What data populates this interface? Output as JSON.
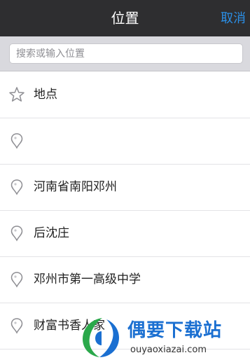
{
  "navbar": {
    "title": "位置",
    "cancel_label": "取消"
  },
  "search": {
    "placeholder": "搜索或输入位置",
    "value": ""
  },
  "list": {
    "items": [
      {
        "icon": "star-icon",
        "label": "地点"
      },
      {
        "icon": "location-pin-icon",
        "label": ""
      },
      {
        "icon": "location-pin-icon",
        "label": "河南省南阳邓州"
      },
      {
        "icon": "location-pin-icon",
        "label": "后沈庄"
      },
      {
        "icon": "location-pin-icon",
        "label": "邓州市第一高级中学"
      },
      {
        "icon": "location-pin-icon",
        "label": "财富书香人家"
      }
    ]
  },
  "watermark": {
    "title": "偶要下载站",
    "url": "ouyaoxiazai.com"
  },
  "colors": {
    "navbar_bg": "#2e2e30",
    "accent": "#2b8fe6",
    "search_bar_bg": "#d9d9de",
    "icon_gray": "#8e8e93"
  }
}
